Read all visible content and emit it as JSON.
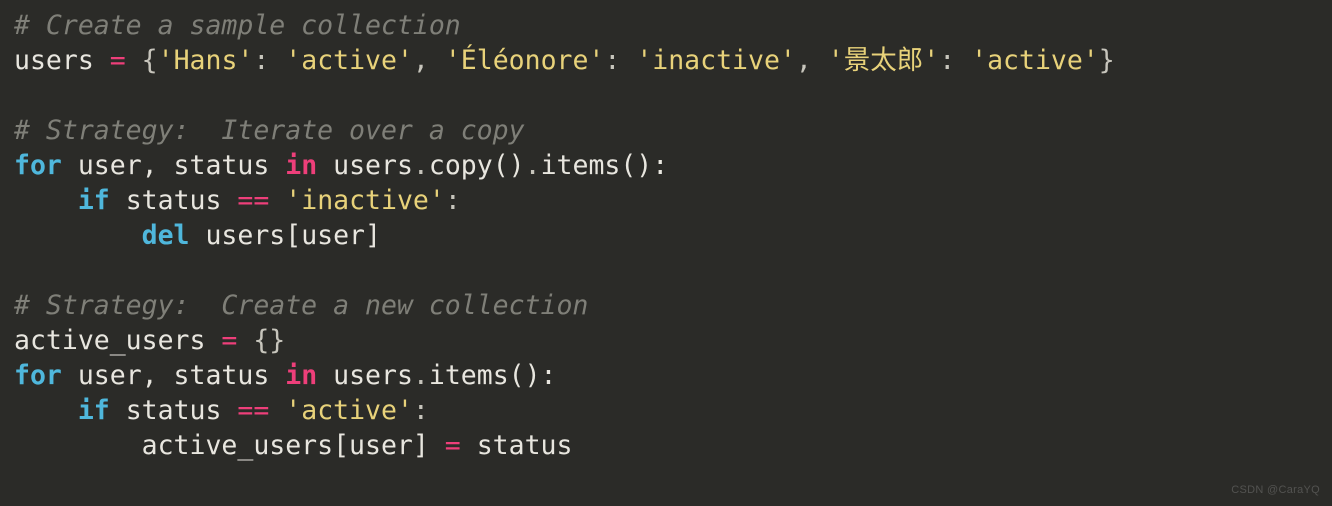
{
  "code": {
    "c1": "# Create a sample collection",
    "l2a": "users ",
    "l2b": "= ",
    "l2c": "{",
    "l2d": "'Hans'",
    "l2e": ": ",
    "l2f": "'active'",
    "l2g": ", ",
    "l2h": "'Éléonore'",
    "l2i": ": ",
    "l2j": "'inactive'",
    "l2k": ", ",
    "l2l": "'景太郎'",
    "l2m": ": ",
    "l2n": "'active'",
    "l2o": "}",
    "c2": "# Strategy:  Iterate over a copy",
    "l4a": "for",
    "l4b": " user, status ",
    "l4c": "in",
    "l4d": " users",
    "l4e": ".",
    "l4f": "copy()",
    "l4g": ".",
    "l4h": "items():",
    "l5a": "    ",
    "l5b": "if",
    "l5c": " status ",
    "l5d": "==",
    "l5e": " ",
    "l5f": "'inactive'",
    "l5g": ":",
    "l6a": "        ",
    "l6b": "del",
    "l6c": " users[user]",
    "c3": "# Strategy:  Create a new collection",
    "l8a": "active_users ",
    "l8b": "= ",
    "l8c": "{}",
    "l9a": "for",
    "l9b": " user, status ",
    "l9c": "in",
    "l9d": " users",
    "l9e": ".",
    "l9f": "items():",
    "l10a": "    ",
    "l10b": "if",
    "l10c": " status ",
    "l10d": "==",
    "l10e": " ",
    "l10f": "'active'",
    "l10g": ":",
    "l11a": "        active_users[user] ",
    "l11b": "=",
    "l11c": " status"
  },
  "watermark": "CSDN @CaraYQ"
}
